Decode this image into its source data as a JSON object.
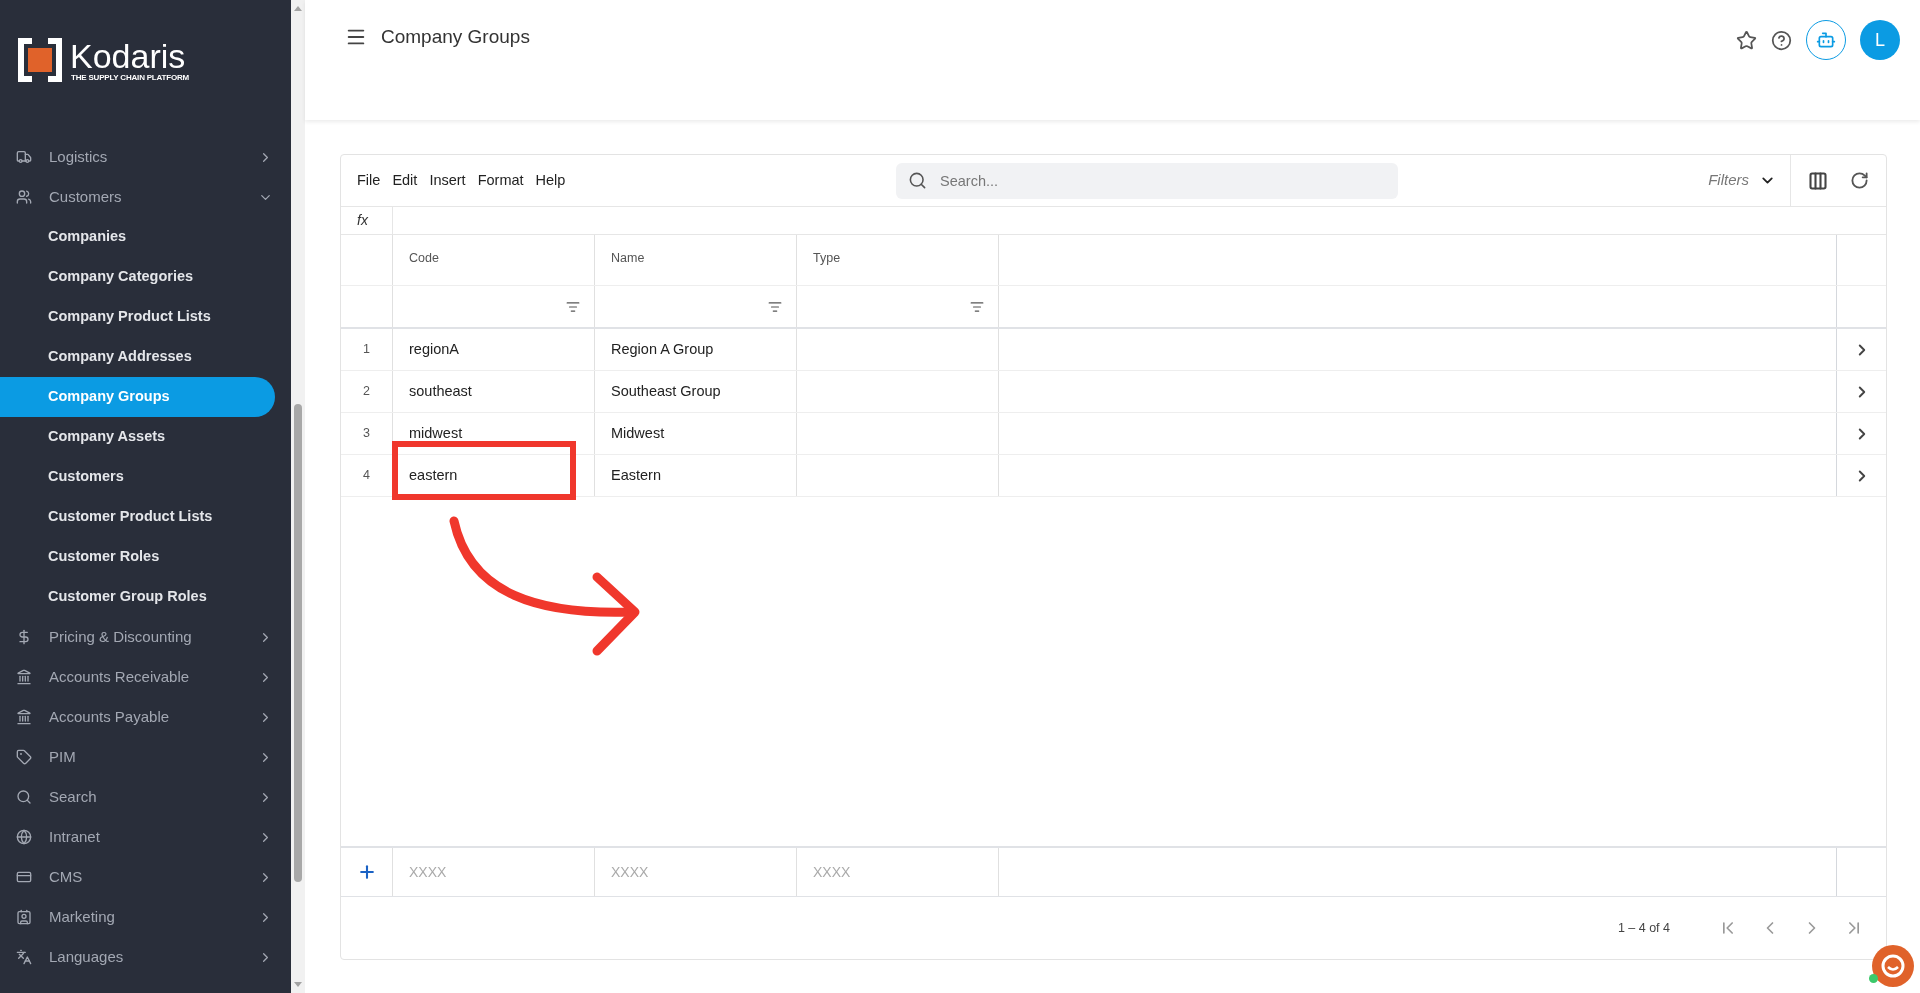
{
  "logo": {
    "name": "Kodaris",
    "tagline": "THE SUPPLY CHAIN PLATFORM"
  },
  "sidebar": {
    "items": [
      {
        "label": "Logistics",
        "expanded": false
      },
      {
        "label": "Customers",
        "expanded": true,
        "children": [
          {
            "label": "Companies",
            "selected": false
          },
          {
            "label": "Company Categories",
            "selected": false
          },
          {
            "label": "Company Product Lists",
            "selected": false
          },
          {
            "label": "Company Addresses",
            "selected": false
          },
          {
            "label": "Company Groups",
            "selected": true
          },
          {
            "label": "Company Assets",
            "selected": false
          },
          {
            "label": "Customers",
            "selected": false
          },
          {
            "label": "Customer Product Lists",
            "selected": false
          },
          {
            "label": "Customer Roles",
            "selected": false
          },
          {
            "label": "Customer Group Roles",
            "selected": false
          }
        ]
      },
      {
        "label": "Pricing & Discounting",
        "expanded": false
      },
      {
        "label": "Accounts Receivable",
        "expanded": false
      },
      {
        "label": "Accounts Payable",
        "expanded": false
      },
      {
        "label": "PIM",
        "expanded": false
      },
      {
        "label": "Search",
        "expanded": false
      },
      {
        "label": "Intranet",
        "expanded": false
      },
      {
        "label": "CMS",
        "expanded": false
      },
      {
        "label": "Marketing",
        "expanded": false
      },
      {
        "label": "Languages",
        "expanded": false
      }
    ]
  },
  "header": {
    "title": "Company Groups",
    "avatar": "L"
  },
  "grid": {
    "menu": [
      "File",
      "Edit",
      "Insert",
      "Format",
      "Help"
    ],
    "search": {
      "placeholder": "Search..."
    },
    "filters": "Filters",
    "formula_label": "fx",
    "columns": [
      "Code",
      "Name",
      "Type"
    ],
    "rows": [
      {
        "number": "1",
        "code": "regionA",
        "name": "Region A Group"
      },
      {
        "number": "2",
        "code": "southeast",
        "name": "Southeast Group"
      },
      {
        "number": "3",
        "code": "midwest",
        "name": "Midwest"
      },
      {
        "number": "4",
        "code": "eastern",
        "name": "Eastern"
      }
    ],
    "new_row": {
      "placeholders": [
        "XXXX",
        "XXXX",
        "XXXX"
      ]
    },
    "pager": "1 – 4 of 4"
  }
}
